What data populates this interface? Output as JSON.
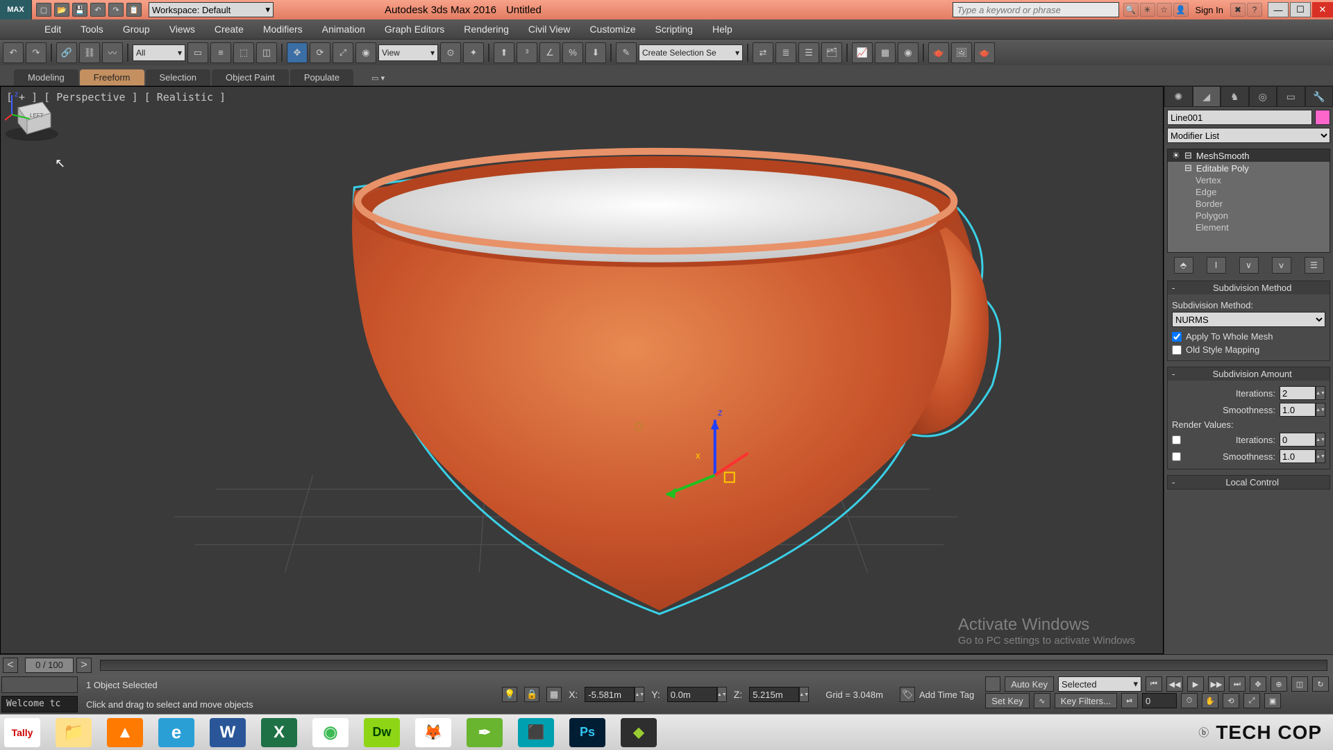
{
  "title": {
    "app": "Autodesk 3ds Max 2016",
    "doc": "Untitled",
    "logo": "MAX"
  },
  "workspace": {
    "label": "Workspace: Default"
  },
  "search": {
    "placeholder": "Type a keyword or phrase"
  },
  "signin": "Sign In",
  "menus": [
    "Edit",
    "Tools",
    "Group",
    "Views",
    "Create",
    "Modifiers",
    "Animation",
    "Graph Editors",
    "Rendering",
    "Civil View",
    "Customize",
    "Scripting",
    "Help"
  ],
  "toolbar_combos": {
    "filter": "All",
    "refcoord": "View",
    "selset": "Create Selection Se"
  },
  "ribbon": {
    "tabs": [
      "Modeling",
      "Freeform",
      "Selection",
      "Object Paint",
      "Populate"
    ],
    "active": 1
  },
  "viewport": {
    "label": "[ + ] [ Perspective ] [ Realistic ]"
  },
  "watermark": {
    "line1": "Activate Windows",
    "line2": "Go to PC settings to activate Windows"
  },
  "panel": {
    "object": "Line001",
    "modlist": "Modifier List",
    "stack": [
      "MeshSmooth",
      "Editable Poly",
      "Vertex",
      "Edge",
      "Border",
      "Polygon",
      "Element"
    ],
    "roll_sub_method": {
      "title": "Subdivision Method",
      "label": "Subdivision Method:",
      "value": "NURMS",
      "chk1": "Apply To Whole Mesh",
      "chk2": "Old Style Mapping"
    },
    "roll_sub_amount": {
      "title": "Subdivision Amount",
      "iter_label": "Iterations:",
      "iter_val": "2",
      "smooth_label": "Smoothness:",
      "smooth_val": "1.0",
      "render_label": "Render Values:",
      "riter_label": "Iterations:",
      "riter_val": "0",
      "rsmooth_label": "Smoothness:",
      "rsmooth_val": "1.0"
    },
    "roll_local": {
      "title": "Local Control"
    }
  },
  "timeline": {
    "pos": "0 / 100"
  },
  "status": {
    "welcome": "Welcome tc",
    "sel": "1 Object Selected",
    "hint": "Click and drag to select and move objects",
    "x_label": "X:",
    "x": "-5.581m",
    "y_label": "Y:",
    "y": "0.0m",
    "z_label": "Z:",
    "z": "5.215m",
    "grid": "Grid = 3.048m",
    "addtag": "Add Time Tag",
    "autokey": "Auto Key",
    "selected": "Selected",
    "setkey": "Set Key",
    "keyfilters": "Key Filters...",
    "frame": "0"
  },
  "taskbar": {
    "apps": [
      {
        "name": "tally",
        "txt": "Tally",
        "bg": "#fff",
        "fg": "#c00",
        "fs": "14"
      },
      {
        "name": "explorer",
        "txt": "📁",
        "bg": "#ffe08a",
        "fg": "#333",
        "fs": "24"
      },
      {
        "name": "vlc",
        "txt": "▲",
        "bg": "#ff7a00",
        "fg": "#fff",
        "fs": "24"
      },
      {
        "name": "ie",
        "txt": "e",
        "bg": "#2a9fd6",
        "fg": "#fff",
        "fs": "26"
      },
      {
        "name": "word",
        "txt": "W",
        "bg": "#2a5699",
        "fg": "#fff",
        "fs": "24"
      },
      {
        "name": "excel",
        "txt": "X",
        "bg": "#1e7145",
        "fg": "#fff",
        "fs": "24"
      },
      {
        "name": "chrome",
        "txt": "◉",
        "bg": "#fff",
        "fg": "#3cba54",
        "fs": "24"
      },
      {
        "name": "dreamweaver",
        "txt": "Dw",
        "bg": "#8ed615",
        "fg": "#004400",
        "fs": "18"
      },
      {
        "name": "firefox",
        "txt": "🦊",
        "bg": "#fff",
        "fg": "#333",
        "fs": "22"
      },
      {
        "name": "corel",
        "txt": "✒",
        "bg": "#69b52f",
        "fg": "#fff",
        "fs": "22"
      },
      {
        "name": "3dsmax",
        "txt": "⬛",
        "bg": "#00a0b0",
        "fg": "#fff",
        "fs": "20"
      },
      {
        "name": "photoshop",
        "txt": "Ps",
        "bg": "#001d34",
        "fg": "#31c5f0",
        "fs": "18"
      },
      {
        "name": "app",
        "txt": "◆",
        "bg": "#2e2e2e",
        "fg": "#9acd32",
        "fs": "20"
      }
    ],
    "watermark": "TECH COP"
  }
}
